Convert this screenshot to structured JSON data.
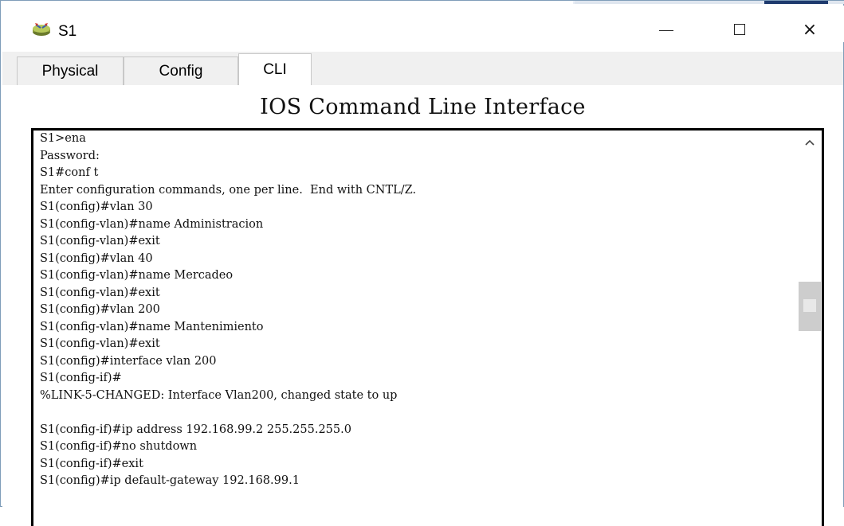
{
  "window": {
    "title": "S1",
    "icon": "switch-device-icon",
    "controls": {
      "minimize": "minimize-icon",
      "maximize": "maximize-icon",
      "close": "×"
    }
  },
  "tabs": [
    {
      "label": "Physical",
      "active": false
    },
    {
      "label": "Config",
      "active": false
    },
    {
      "label": "CLI",
      "active": true
    }
  ],
  "cli": {
    "heading": "IOS Command Line Interface",
    "lines": [
      "S1>ena",
      "Password:",
      "S1#conf t",
      "Enter configuration commands, one per line.  End with CNTL/Z.",
      "S1(config)#vlan 30",
      "S1(config-vlan)#name Administracion",
      "S1(config-vlan)#exit",
      "S1(config)#vlan 40",
      "S1(config-vlan)#name Mercadeo",
      "S1(config-vlan)#exit",
      "S1(config)#vlan 200",
      "S1(config-vlan)#name Mantenimiento",
      "S1(config-vlan)#exit",
      "S1(config)#interface vlan 200",
      "S1(config-if)#",
      "%LINK-5-CHANGED: Interface Vlan200, changed state to up",
      "",
      "S1(config-if)#ip address 192.168.99.2 255.255.255.0",
      "S1(config-if)#no shutdown",
      "S1(config-if)#exit",
      "S1(config)#ip default-gateway 192.168.99.1"
    ]
  },
  "colors": {
    "accent_strip": "#1e3a6e",
    "window_border": "#7f9db9",
    "tab_background": "#f0f0f0"
  }
}
